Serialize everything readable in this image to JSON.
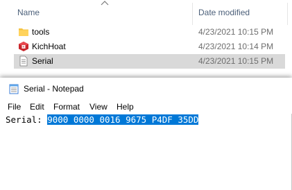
{
  "explorer": {
    "columns": {
      "name": "Name",
      "date_modified": "Date modified"
    },
    "files": [
      {
        "name": "tools",
        "date": "4/23/2021 10:15 PM",
        "icon": "folder-icon"
      },
      {
        "name": "KichHoat",
        "date": "4/23/2021 10:14 PM",
        "icon": "app-icon"
      },
      {
        "name": "Serial",
        "date": "4/23/2021 10:15 PM",
        "icon": "text-file-icon",
        "selected": true
      }
    ]
  },
  "notepad": {
    "title": "Serial - Notepad",
    "menu": [
      "File",
      "Edit",
      "Format",
      "View",
      "Help"
    ],
    "content_prefix": "Serial: ",
    "content_selected": "9000 0000 0016 9675 P4DF 35DD",
    "selection_color": "#0078d7"
  }
}
